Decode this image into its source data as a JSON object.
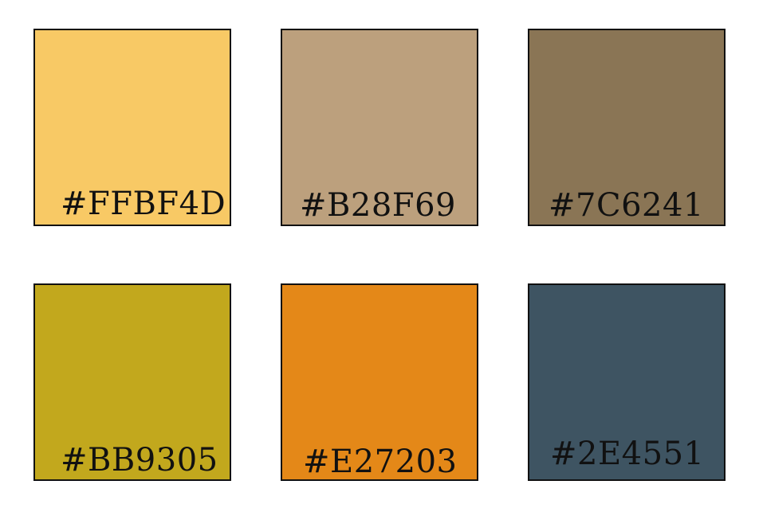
{
  "swatches": [
    {
      "label": "#FFBF4D",
      "color": "#F8C965"
    },
    {
      "label": "#B28F69",
      "color": "#BCA07D"
    },
    {
      "label": "#7C6241",
      "color": "#8A7555"
    },
    {
      "label": "#BB9305",
      "color": "#C2A81D"
    },
    {
      "label": "#E27203",
      "color": "#E48818"
    },
    {
      "label": "#2E4551",
      "color": "#3E5462"
    }
  ]
}
